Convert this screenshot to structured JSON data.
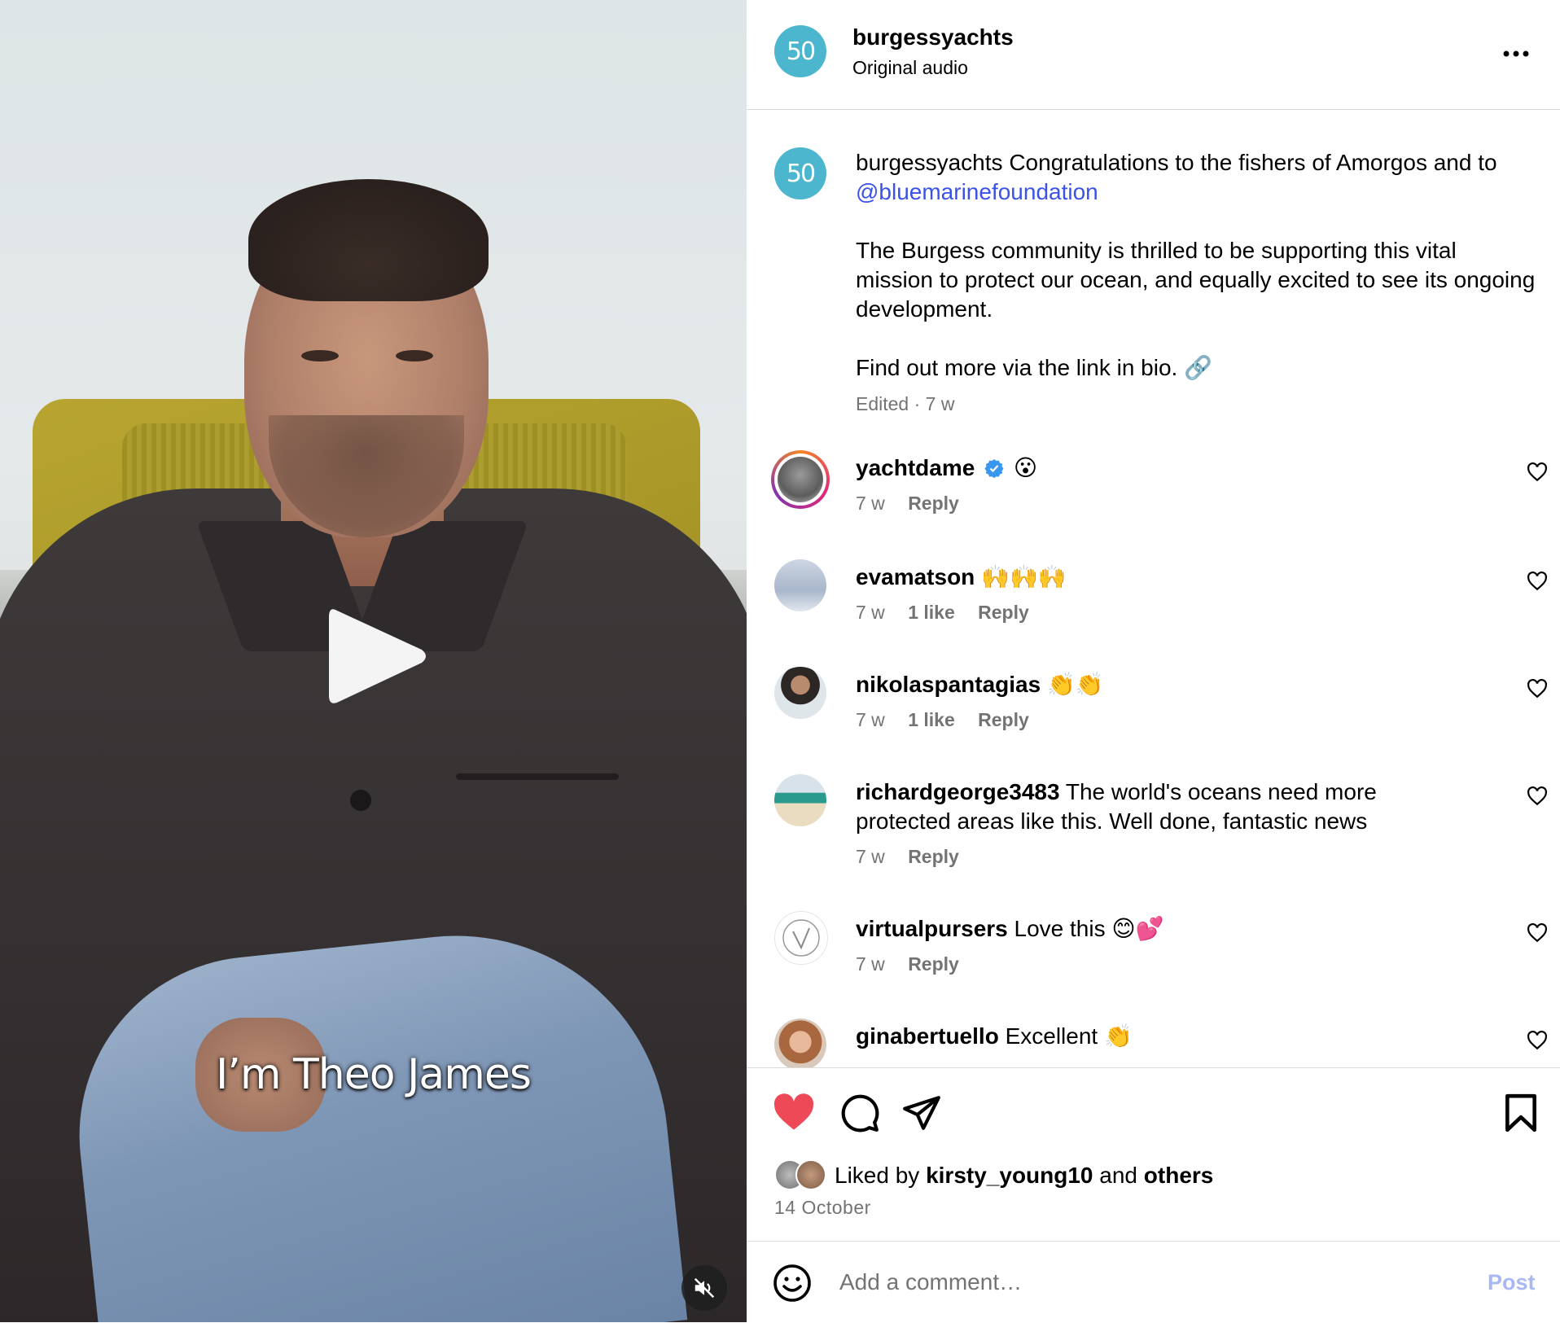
{
  "video": {
    "caption": "I’m Theo James",
    "play_icon": "play-icon",
    "mute_icon": "muted-speaker-icon"
  },
  "header": {
    "username": "burgessyachts",
    "subtitle": "Original audio",
    "avatar_text": "50",
    "more_icon": "more-horizontal-icon"
  },
  "post_caption": {
    "username": "burgessyachts",
    "line1": "Congratulations to the fishers of Amorgos and to",
    "mention": "@bluemarinefoundation",
    "para2": "The Burgess community is thrilled to be supporting this vital mission to protect our ocean, and equally excited to see its ongoing development.",
    "para3": "Find out more via the link in bio. 🔗",
    "meta": "Edited · 7 w"
  },
  "comments": [
    {
      "user": "yachtdame",
      "verified": true,
      "text": "😮",
      "time": "7 w",
      "likes": "",
      "reply": "Reply"
    },
    {
      "user": "evamatson",
      "verified": false,
      "text": "🙌🙌🙌",
      "time": "7 w",
      "likes": "1 like",
      "reply": "Reply"
    },
    {
      "user": "nikolaspantagias",
      "verified": false,
      "text": "👏👏",
      "time": "7 w",
      "likes": "1 like",
      "reply": "Reply"
    },
    {
      "user": "richardgeorge3483",
      "verified": false,
      "text": "The world's oceans need more protected areas like this. Well done, fantastic news",
      "time": "7 w",
      "likes": "",
      "reply": "Reply"
    },
    {
      "user": "virtualpursers",
      "verified": false,
      "text": "Love this 😊💕",
      "time": "7 w",
      "likes": "",
      "reply": "Reply"
    },
    {
      "user": "ginabertuello",
      "verified": false,
      "text": "Excellent 👏",
      "time": "",
      "likes": "",
      "reply": ""
    }
  ],
  "actions": {
    "like_icon": "heart-filled-icon",
    "comment_icon": "comment-bubble-icon",
    "share_icon": "send-icon",
    "save_icon": "bookmark-icon",
    "liked_prefix": "Liked by",
    "liked_user": "kirsty_young10",
    "liked_and": "and",
    "liked_others": "others",
    "date": "14 October"
  },
  "comment_bar": {
    "emoji_icon": "emoji-smile-icon",
    "placeholder": "Add a comment…",
    "post_label": "Post"
  },
  "colors": {
    "brand_teal": "#4db6cf",
    "like_red": "#ed4956",
    "mention_blue": "#3a52e8",
    "verified_blue": "#3897f0",
    "muted_text": "#737373"
  }
}
